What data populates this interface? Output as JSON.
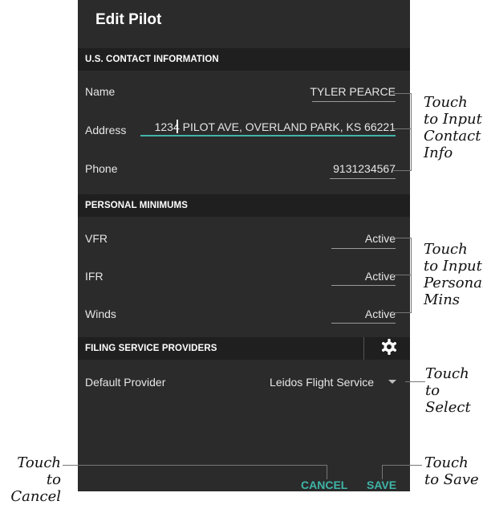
{
  "screen": {
    "title": "Edit Pilot",
    "contact": {
      "header": "U.S. CONTACT INFORMATION",
      "name_label": "Name",
      "name_value": "TYLER PEARCE",
      "address_label": "Address",
      "address_value": "1234 PILOT AVE, OVERLAND PARK, KS 66221",
      "phone_label": "Phone",
      "phone_value": "9131234567"
    },
    "minimums": {
      "header": "PERSONAL MINIMUMS",
      "vfr_label": "VFR",
      "vfr_value": "Active",
      "ifr_label": "IFR",
      "ifr_value": "Active",
      "winds_label": "Winds",
      "winds_value": "Active"
    },
    "providers": {
      "header": "FILING SERVICE PROVIDERS",
      "default_label": "Default Provider",
      "default_value": "Leidos Flight Service"
    },
    "buttons": {
      "cancel": "CANCEL",
      "save": "SAVE"
    }
  },
  "annotations": {
    "contact_1": "Touch",
    "contact_2": "to Input",
    "contact_3": "Contact",
    "contact_4": "Info",
    "mins_1": "Touch",
    "mins_2": "to Input",
    "mins_3": "Personal",
    "mins_4": "Mins",
    "select_1": "Touch to",
    "select_2": "Select",
    "cancel_1": "Touch to",
    "cancel_2": "Cancel",
    "save_1": "Touch",
    "save_2": "to Save"
  },
  "colors": {
    "background": "#2b2b2b",
    "section_header": "#1f1f1f",
    "accent": "#3fb5a8"
  },
  "icons": [
    "gear-icon",
    "chevron-down-icon"
  ]
}
